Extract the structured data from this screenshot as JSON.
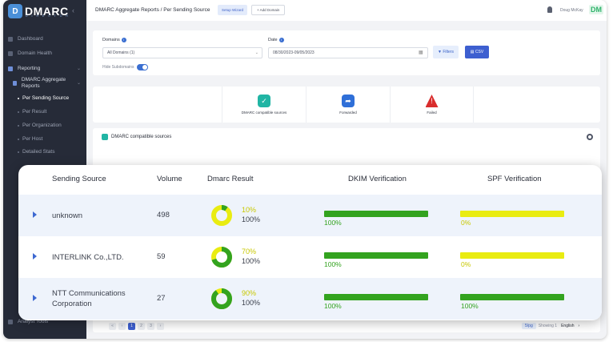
{
  "app": {
    "logo_text": "DMARC",
    "logo_sub": "D I R E C T O R",
    "logo_glyph": "D"
  },
  "sidebar": {
    "items": [
      {
        "label": "Dashboard"
      },
      {
        "label": "Domain Health"
      },
      {
        "label": "Reporting"
      },
      {
        "label": "DMARC Aggregate Reports"
      },
      {
        "label": "Per Sending Source"
      },
      {
        "label": "Per Result"
      },
      {
        "label": "Per Organization"
      },
      {
        "label": "Per Host"
      },
      {
        "label": "Detailed Stats"
      },
      {
        "label": "Analyst Tools"
      }
    ]
  },
  "header": {
    "breadcrumb": "DMARC Aggregate Reports / Per Sending Source",
    "setup_wizard": "Setup Wizard",
    "add_domain": "+ Add Domain",
    "user_name": "Doug McKay",
    "avatar_initials": "DM"
  },
  "filters": {
    "domains_label": "Domains",
    "domains_value": "All Domains (1)",
    "date_label": "Date",
    "date_value": "08/30/2023-09/05/2023",
    "filters_button": "Filters",
    "csv_button": "CSV",
    "hide_subdomains": "Hide Subdomains"
  },
  "summary": {
    "items": [
      {
        "label": "DMARC compatible sources",
        "color": "#21b5a4"
      },
      {
        "label": "Forwarded",
        "color": "#2f6fd8"
      },
      {
        "label": "Failed",
        "color": "#d92d2d"
      }
    ]
  },
  "sources": {
    "title": "DMARC compatible sources",
    "pages": [
      "1",
      "2",
      "3"
    ],
    "rows_per_page": "5/pg",
    "showing": "Showing 1",
    "language": "English"
  },
  "table": {
    "headers": {
      "source": "Sending Source",
      "volume": "Volume",
      "dmarc": "Dmarc Result",
      "dkim": "DKIM Verification",
      "spf": "SPF Verification"
    },
    "colors": {
      "pass": "#33a31f",
      "fail": "#e9ec11",
      "pass_text": "#c8c800"
    },
    "rows": [
      {
        "source_line1": "unknown",
        "source_line2": "",
        "volume": "498",
        "dmarc_pass": "10%",
        "dmarc_total": "100%",
        "dmarc_fraction": 0.1,
        "dkim": "100%",
        "dkim_fraction": 1.0,
        "spf": "0%",
        "spf_fraction": 0.0
      },
      {
        "source_line1": "INTERLINK Co.,LTD.",
        "source_line2": "",
        "volume": "59",
        "dmarc_pass": "70%",
        "dmarc_total": "100%",
        "dmarc_fraction": 0.7,
        "dkim": "100%",
        "dkim_fraction": 1.0,
        "spf": "0%",
        "spf_fraction": 0.0
      },
      {
        "source_line1": "NTT Communications",
        "source_line2": "Corporation",
        "volume": "27",
        "dmarc_pass": "90%",
        "dmarc_total": "100%",
        "dmarc_fraction": 0.9,
        "dkim": "100%",
        "dkim_fraction": 1.0,
        "spf": "100%",
        "spf_fraction": 1.0
      }
    ]
  }
}
